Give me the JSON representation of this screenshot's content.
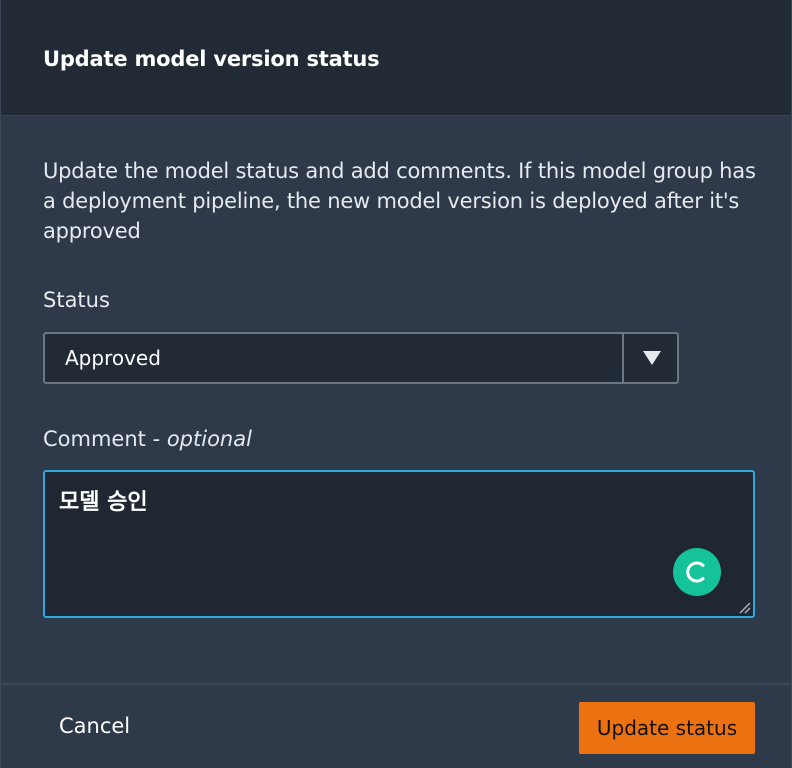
{
  "modal": {
    "title": "Update model version status",
    "description": "Update the model status and add comments. If this model group has a deployment pipeline, the new model version is deployed after it's approved"
  },
  "status_field": {
    "label": "Status",
    "selected_value": "Approved",
    "icon": "caret-down-icon"
  },
  "comment_field": {
    "label": "Comment - ",
    "label_suffix": "optional",
    "value": "모델 승인",
    "assistant_icon": "grammarly-icon"
  },
  "footer": {
    "cancel_label": "Cancel",
    "submit_label": "Update status"
  },
  "colors": {
    "accent": "#ec7211",
    "focus": "#2ea8e0",
    "assistant_badge": "#15c39a"
  }
}
